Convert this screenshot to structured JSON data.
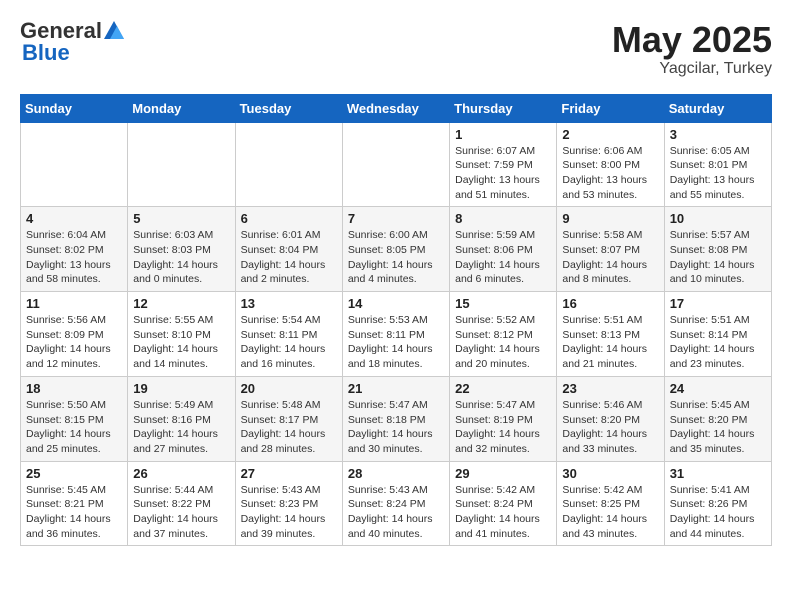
{
  "header": {
    "logo_general": "General",
    "logo_blue": "Blue",
    "title": "May 2025",
    "location": "Yagcilar, Turkey"
  },
  "weekdays": [
    "Sunday",
    "Monday",
    "Tuesday",
    "Wednesday",
    "Thursday",
    "Friday",
    "Saturday"
  ],
  "weeks": [
    [
      {
        "day": "",
        "info": ""
      },
      {
        "day": "",
        "info": ""
      },
      {
        "day": "",
        "info": ""
      },
      {
        "day": "",
        "info": ""
      },
      {
        "day": "1",
        "info": "Sunrise: 6:07 AM\nSunset: 7:59 PM\nDaylight: 13 hours\nand 51 minutes."
      },
      {
        "day": "2",
        "info": "Sunrise: 6:06 AM\nSunset: 8:00 PM\nDaylight: 13 hours\nand 53 minutes."
      },
      {
        "day": "3",
        "info": "Sunrise: 6:05 AM\nSunset: 8:01 PM\nDaylight: 13 hours\nand 55 minutes."
      }
    ],
    [
      {
        "day": "4",
        "info": "Sunrise: 6:04 AM\nSunset: 8:02 PM\nDaylight: 13 hours\nand 58 minutes."
      },
      {
        "day": "5",
        "info": "Sunrise: 6:03 AM\nSunset: 8:03 PM\nDaylight: 14 hours\nand 0 minutes."
      },
      {
        "day": "6",
        "info": "Sunrise: 6:01 AM\nSunset: 8:04 PM\nDaylight: 14 hours\nand 2 minutes."
      },
      {
        "day": "7",
        "info": "Sunrise: 6:00 AM\nSunset: 8:05 PM\nDaylight: 14 hours\nand 4 minutes."
      },
      {
        "day": "8",
        "info": "Sunrise: 5:59 AM\nSunset: 8:06 PM\nDaylight: 14 hours\nand 6 minutes."
      },
      {
        "day": "9",
        "info": "Sunrise: 5:58 AM\nSunset: 8:07 PM\nDaylight: 14 hours\nand 8 minutes."
      },
      {
        "day": "10",
        "info": "Sunrise: 5:57 AM\nSunset: 8:08 PM\nDaylight: 14 hours\nand 10 minutes."
      }
    ],
    [
      {
        "day": "11",
        "info": "Sunrise: 5:56 AM\nSunset: 8:09 PM\nDaylight: 14 hours\nand 12 minutes."
      },
      {
        "day": "12",
        "info": "Sunrise: 5:55 AM\nSunset: 8:10 PM\nDaylight: 14 hours\nand 14 minutes."
      },
      {
        "day": "13",
        "info": "Sunrise: 5:54 AM\nSunset: 8:11 PM\nDaylight: 14 hours\nand 16 minutes."
      },
      {
        "day": "14",
        "info": "Sunrise: 5:53 AM\nSunset: 8:11 PM\nDaylight: 14 hours\nand 18 minutes."
      },
      {
        "day": "15",
        "info": "Sunrise: 5:52 AM\nSunset: 8:12 PM\nDaylight: 14 hours\nand 20 minutes."
      },
      {
        "day": "16",
        "info": "Sunrise: 5:51 AM\nSunset: 8:13 PM\nDaylight: 14 hours\nand 21 minutes."
      },
      {
        "day": "17",
        "info": "Sunrise: 5:51 AM\nSunset: 8:14 PM\nDaylight: 14 hours\nand 23 minutes."
      }
    ],
    [
      {
        "day": "18",
        "info": "Sunrise: 5:50 AM\nSunset: 8:15 PM\nDaylight: 14 hours\nand 25 minutes."
      },
      {
        "day": "19",
        "info": "Sunrise: 5:49 AM\nSunset: 8:16 PM\nDaylight: 14 hours\nand 27 minutes."
      },
      {
        "day": "20",
        "info": "Sunrise: 5:48 AM\nSunset: 8:17 PM\nDaylight: 14 hours\nand 28 minutes."
      },
      {
        "day": "21",
        "info": "Sunrise: 5:47 AM\nSunset: 8:18 PM\nDaylight: 14 hours\nand 30 minutes."
      },
      {
        "day": "22",
        "info": "Sunrise: 5:47 AM\nSunset: 8:19 PM\nDaylight: 14 hours\nand 32 minutes."
      },
      {
        "day": "23",
        "info": "Sunrise: 5:46 AM\nSunset: 8:20 PM\nDaylight: 14 hours\nand 33 minutes."
      },
      {
        "day": "24",
        "info": "Sunrise: 5:45 AM\nSunset: 8:20 PM\nDaylight: 14 hours\nand 35 minutes."
      }
    ],
    [
      {
        "day": "25",
        "info": "Sunrise: 5:45 AM\nSunset: 8:21 PM\nDaylight: 14 hours\nand 36 minutes."
      },
      {
        "day": "26",
        "info": "Sunrise: 5:44 AM\nSunset: 8:22 PM\nDaylight: 14 hours\nand 37 minutes."
      },
      {
        "day": "27",
        "info": "Sunrise: 5:43 AM\nSunset: 8:23 PM\nDaylight: 14 hours\nand 39 minutes."
      },
      {
        "day": "28",
        "info": "Sunrise: 5:43 AM\nSunset: 8:24 PM\nDaylight: 14 hours\nand 40 minutes."
      },
      {
        "day": "29",
        "info": "Sunrise: 5:42 AM\nSunset: 8:24 PM\nDaylight: 14 hours\nand 41 minutes."
      },
      {
        "day": "30",
        "info": "Sunrise: 5:42 AM\nSunset: 8:25 PM\nDaylight: 14 hours\nand 43 minutes."
      },
      {
        "day": "31",
        "info": "Sunrise: 5:41 AM\nSunset: 8:26 PM\nDaylight: 14 hours\nand 44 minutes."
      }
    ]
  ]
}
